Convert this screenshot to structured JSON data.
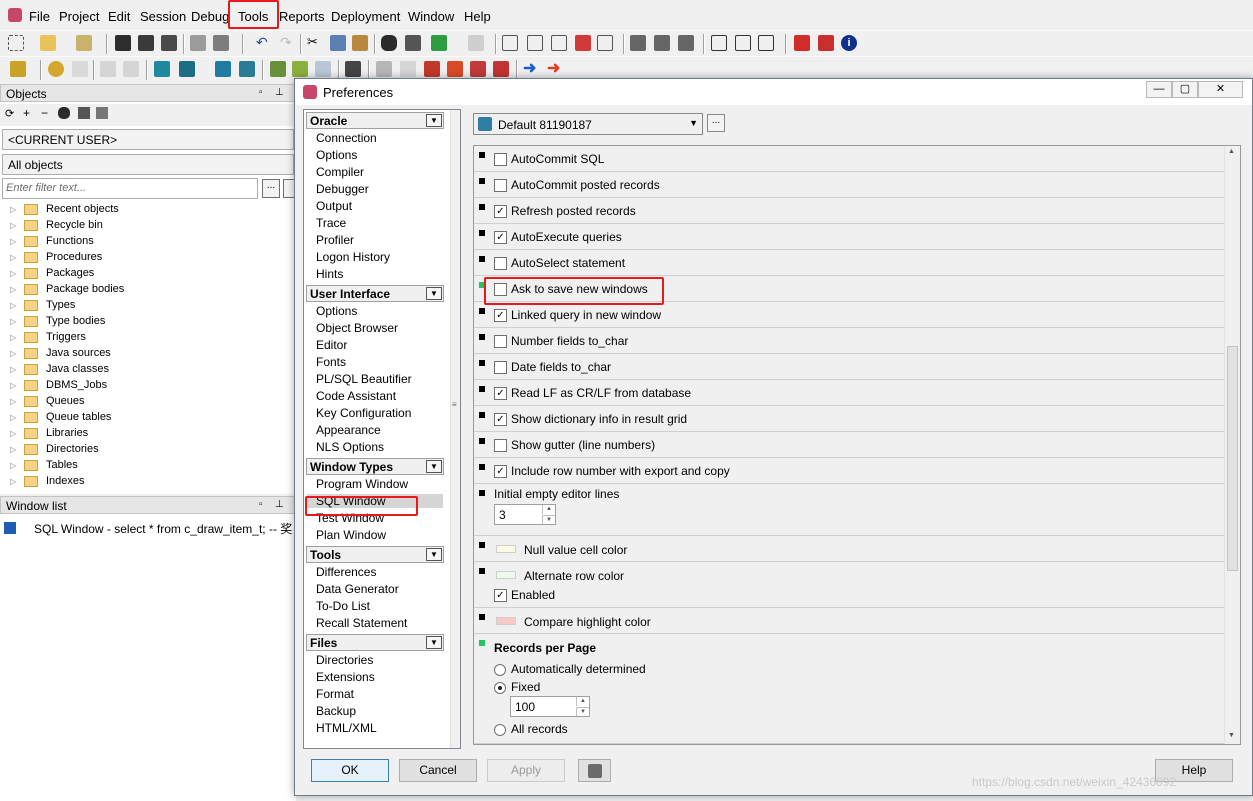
{
  "menu": {
    "items": [
      "File",
      "Project",
      "Edit",
      "Session",
      "Debug",
      "Tools",
      "Reports",
      "Deployment",
      "Window",
      "Help"
    ]
  },
  "toolbar": {
    "row1_icons": [
      "new-icon",
      "open-icon",
      "open-dropdown-icon",
      "save-icon",
      "save-all-icon",
      "save-as-icon",
      "print-icon",
      "print-setup-icon",
      "undo-icon",
      "redo-icon",
      "cut-icon",
      "copy-icon",
      "paste-icon",
      "find-icon",
      "replace-icon",
      "goto-icon",
      "bookmark-icon",
      "indent-icon",
      "unindent-icon",
      "comment-icon",
      "uncomment-icon",
      "upper-icon",
      "lower-icon",
      "tile-icon",
      "cascade-icon",
      "window-list-icon",
      "oracle-icon",
      "pdf-icon",
      "info-icon"
    ],
    "row2_icons": [
      "key-icon",
      "debug-icon",
      "run-icon",
      "commit-icon",
      "rollback-icon",
      "sql-window-icon",
      "db-icon",
      "explain-icon",
      "sql-icon",
      "schema-icon",
      "report-icon",
      "wrench-icon",
      "stop-icon",
      "clear-icon",
      "break-icon",
      "step-icon",
      "step-over-icon",
      "arrow-right-icon",
      "arrow-right-red-icon"
    ]
  },
  "objects_panel": {
    "title": "Objects",
    "user_combo": "<CURRENT USER>",
    "scope_combo": "All objects",
    "filter_placeholder": "Enter filter text...",
    "tree": [
      "Recent objects",
      "Recycle bin",
      "Functions",
      "Procedures",
      "Packages",
      "Package bodies",
      "Types",
      "Type bodies",
      "Triggers",
      "Java sources",
      "Java classes",
      "DBMS_Jobs",
      "Queues",
      "Queue tables",
      "Libraries",
      "Directories",
      "Tables",
      "Indexes"
    ]
  },
  "window_list": {
    "title": "Window list",
    "item": "SQL Window - select * from c_draw_item_t; -- 奖"
  },
  "dialog": {
    "title": "Preferences",
    "profile": "Default 81190187",
    "categories": [
      {
        "header": "Oracle",
        "items": [
          "Connection",
          "Options",
          "Compiler",
          "Debugger",
          "Output",
          "Trace",
          "Profiler",
          "Logon History",
          "Hints"
        ]
      },
      {
        "header": "User Interface",
        "items": [
          "Options",
          "Object Browser",
          "Editor",
          "Fonts",
          "PL/SQL Beautifier",
          "Code Assistant",
          "Key Configuration",
          "Appearance",
          "NLS Options"
        ]
      },
      {
        "header": "Window Types",
        "items": [
          "Program Window",
          "SQL Window",
          "Test Window",
          "Plan Window"
        ]
      },
      {
        "header": "Tools",
        "items": [
          "Differences",
          "Data Generator",
          "To-Do List",
          "Recall Statement"
        ]
      },
      {
        "header": "Files",
        "items": [
          "Directories",
          "Extensions",
          "Format",
          "Backup",
          "HTML/XML"
        ]
      }
    ],
    "selected_category": "SQL Window",
    "settings": [
      {
        "label": "AutoCommit SQL",
        "checked": false
      },
      {
        "label": "AutoCommit posted records",
        "checked": false
      },
      {
        "label": "Refresh posted records",
        "checked": true
      },
      {
        "label": "AutoExecute queries",
        "checked": true
      },
      {
        "label": "AutoSelect statement",
        "checked": false
      },
      {
        "label": "Ask to save new windows",
        "checked": false
      },
      {
        "label": "Linked query in new window",
        "checked": true
      },
      {
        "label": "Number fields to_char",
        "checked": false
      },
      {
        "label": "Date fields to_char",
        "checked": false
      },
      {
        "label": "Read LF as CR/LF from database",
        "checked": true
      },
      {
        "label": "Show dictionary info in result grid",
        "checked": true
      },
      {
        "label": "Show gutter (line numbers)",
        "checked": false
      },
      {
        "label": "Include row number with export and copy",
        "checked": true
      }
    ],
    "initial_lines_label": "Initial empty editor lines",
    "initial_lines_value": "3",
    "null_color_label": "Null value cell color",
    "alt_row_label": "Alternate row color",
    "alt_row_enabled_label": "Enabled",
    "compare_label": "Compare highlight color",
    "records_header": "Records per Page",
    "records_options": [
      "Automatically determined",
      "Fixed",
      "All records"
    ],
    "records_selected": "Fixed",
    "records_fixed_value": "100",
    "buttons": {
      "ok": "OK",
      "cancel": "Cancel",
      "apply": "Apply",
      "help": "Help"
    },
    "colors": {
      "null_cell": "#fbfbe8",
      "alt_row": "#eef9ee",
      "compare": "#f7c9c9",
      "marker_green": "#22c55e",
      "highlight_box": "#e8191b"
    }
  },
  "watermark": "https://blog.csdn.net/weixin_42436092"
}
